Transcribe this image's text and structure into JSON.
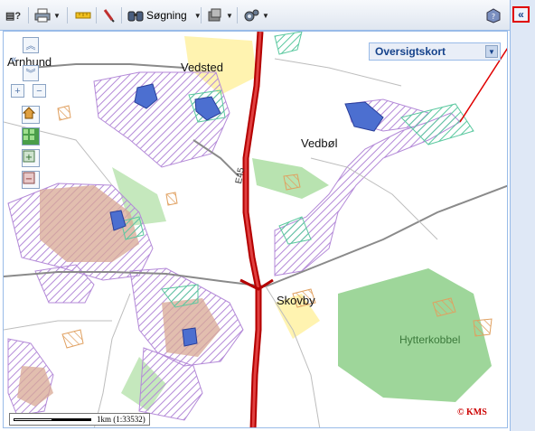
{
  "toolbar": {
    "search_label": "Søgning",
    "colors": {
      "background": "#dfe6f0",
      "border": "#99bbe8"
    }
  },
  "sidebar": {
    "collapse_icon": "double-chevron-left-icon"
  },
  "map": {
    "overview_label": "Oversigtskort",
    "towns": [
      "Arnhund",
      "Vedsted",
      "Vedbøl",
      "Skovby"
    ],
    "forest_label": "Hytterkobbel",
    "road_label": "E45",
    "scale_text": "1km (1:33532)",
    "copyright": "© KMS",
    "colors": {
      "motorway": "#b40000",
      "protected_hatch": "#b48ad8",
      "forest": "#9ed69a",
      "water": "#4c6fd0",
      "annotation_arrow": "#e00000"
    }
  }
}
